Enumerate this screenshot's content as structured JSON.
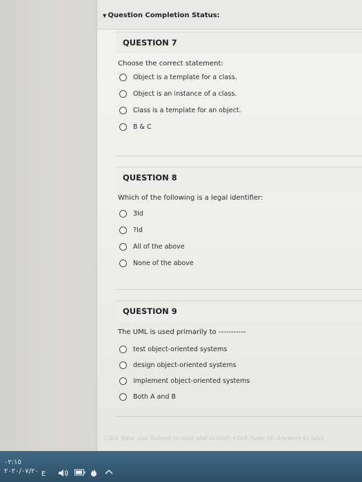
{
  "status": {
    "label": "Question Completion Status:"
  },
  "questions": [
    {
      "title": "QUESTION 7",
      "text": "Choose the correct statement:",
      "options": [
        "Object is a template for a class.",
        "Object is an instance of a class.",
        "Class is a template for an object.",
        "B & C"
      ]
    },
    {
      "title": "QUESTION 8",
      "text": "Which of the following is a legal identifier:",
      "options": [
        "3Id",
        "?Id",
        "All of the above",
        "None of the above"
      ]
    },
    {
      "title": "QUESTION 9",
      "text": "The UML is used primarily to -----------",
      "options": [
        "test object-oriented systems",
        "design object-oriented systems",
        "implement object-oriented systems",
        "Both A and B"
      ]
    }
  ],
  "footer": {
    "note": "Click Save and Submit to save and submit. Click Save All Answers to save"
  },
  "taskbar": {
    "time": "٠٢:١٥",
    "date": "٢٠٢٠/٠٧/٢٠",
    "lang": "E",
    "volume_icon": "speaker-icon",
    "battery_icon": "battery-icon",
    "tray_icon": "chevron-up-icon"
  }
}
